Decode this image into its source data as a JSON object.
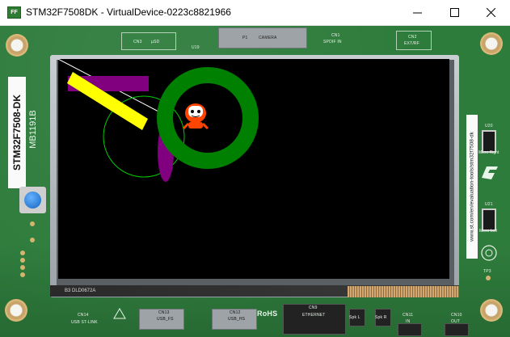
{
  "window": {
    "icon_text": "FF",
    "title": "STM32F7508DK - VirtualDevice-0223c8821966"
  },
  "board": {
    "name": "STM32F7508-DK",
    "revision": "MB1191B",
    "url": "www.st.com/en/evaluation-tools/stm32f7508-dk",
    "lcd_label": "B3 DLD0672A",
    "silkscreen": {
      "cn3": "CN3",
      "usd": "µSD",
      "u19": "U19",
      "p1": "P1",
      "camera": "CAMERA",
      "cn1_top": "CN1",
      "spdif": "SPDIF IN",
      "cn2": "CN2",
      "ext_rf": "EXT/RF",
      "u20": "U20",
      "micro_right": "Micro Right",
      "u21": "U21",
      "micro_left": "Micro Left",
      "tp3": "TP3",
      "cn14": "CN14",
      "usb_stlink": "USB ST-LINK",
      "cn13": "CN13",
      "usb_fs": "USB_FS",
      "cn12": "CN12",
      "usb_hs": "USB_HS",
      "rohs": "RoHS",
      "cn9": "CN9",
      "ethernet": "ETHERNET",
      "spk_l": "Spk L",
      "spk_r": "Spk R",
      "cn11": "CN11",
      "in": "IN",
      "cn10": "CN10",
      "out": "OUT"
    }
  },
  "colors": {
    "pcb": "#2e7c3c",
    "screen_bg": "#000000",
    "ring": "#008000",
    "bar_yellow": "#ffff00",
    "rect_purple": "#800080",
    "ellipse_purple": "#800080",
    "circle_outline": "#00cc00",
    "line_white": "#ffffff",
    "mascot": "#ff4500",
    "user_button": "#1e88e5"
  }
}
